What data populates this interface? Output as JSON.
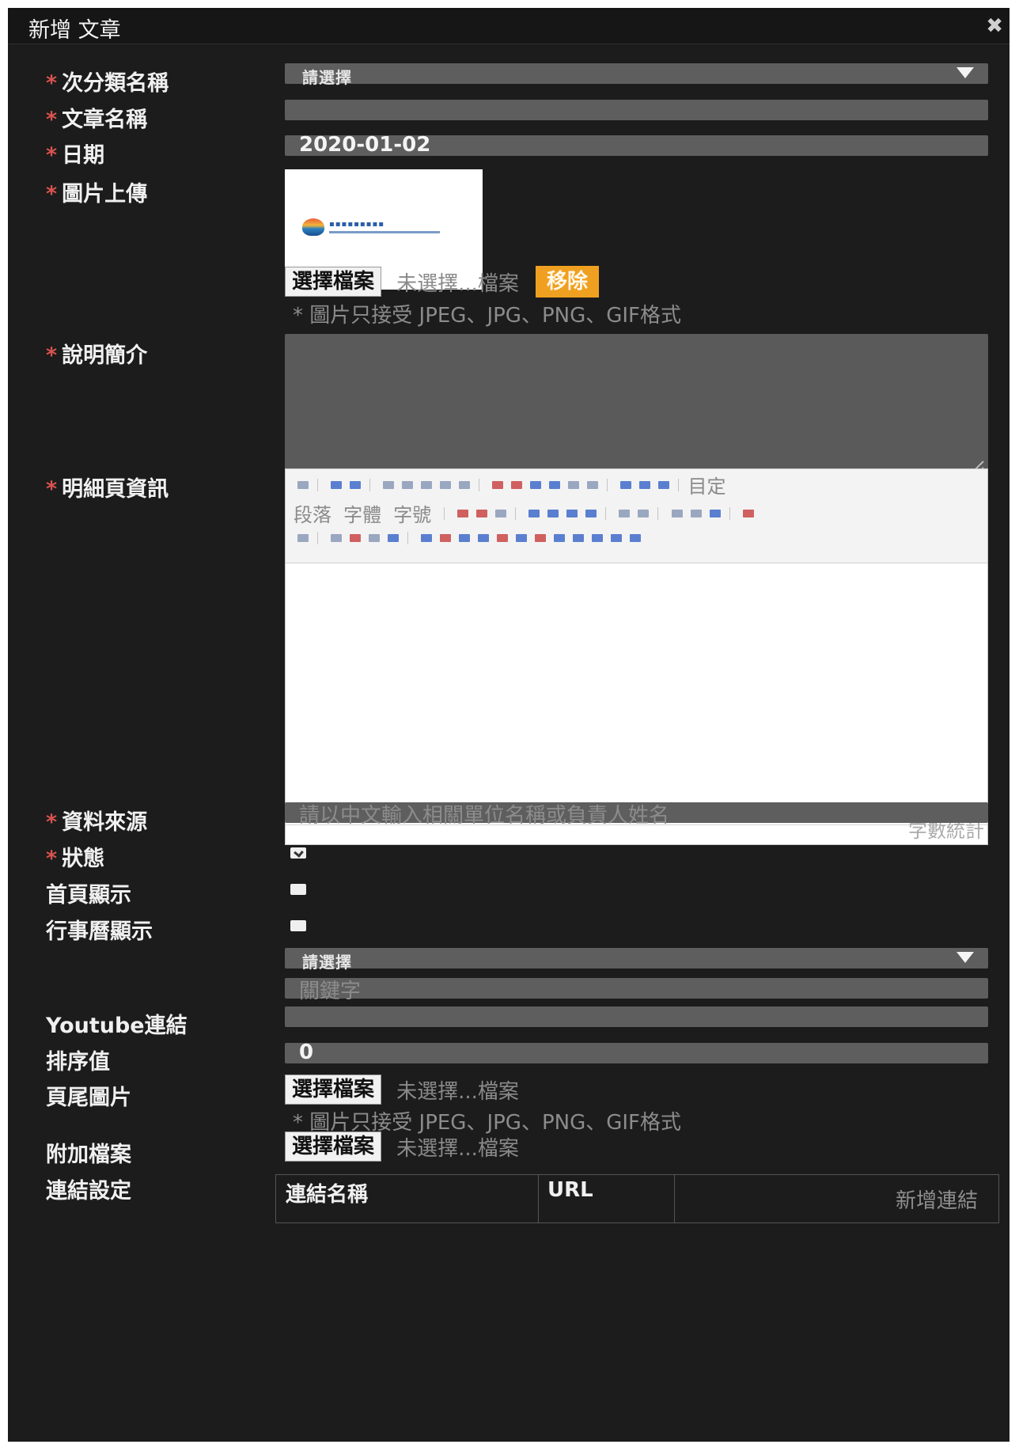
{
  "dialog": {
    "title": "新增 文章",
    "close_glyph": "✖"
  },
  "required_mark": "*",
  "fields": {
    "subcategory": {
      "label": "次分類名稱",
      "placeholder": "請選擇"
    },
    "article_name": {
      "label": "文章名稱",
      "value": ""
    },
    "date": {
      "label": "日期",
      "value": "2020-01-02"
    },
    "image_upload": {
      "label": "圖片上傳",
      "choose_button": "選擇檔案",
      "no_file": "未選擇...檔案",
      "remove_button": "移除",
      "hint": "* 圖片只接受 JPEG、JPG、PNG、GIF格式"
    },
    "description": {
      "label": "說明簡介",
      "value": ""
    },
    "detail_info": {
      "label": "明細頁資訊",
      "toolbar_dropdowns": [
        "段落",
        "字體",
        "字號"
      ],
      "toolbar_right": "目定",
      "word_count": "字數統計"
    },
    "data_source": {
      "label": "資料來源",
      "placeholder": "請以中文輸入相關單位名稱或負責人姓名"
    },
    "status": {
      "label": "狀態",
      "checked": true
    },
    "homepage_display": {
      "label": "首頁顯示",
      "checked": false
    },
    "calendar_display": {
      "label": "行事曆顯示",
      "checked": false
    },
    "keyword_select": {
      "placeholder": "請選擇"
    },
    "keyword": {
      "placeholder": "關鍵字"
    },
    "youtube": {
      "label": "Youtube連結",
      "value": ""
    },
    "sort": {
      "label": "排序值",
      "value": "0"
    },
    "footer_image": {
      "label": "頁尾圖片",
      "choose_button": "選擇檔案",
      "no_file": "未選擇...檔案",
      "hint": "* 圖片只接受 JPEG、JPG、PNG、GIF格式"
    },
    "attachment": {
      "label": "附加檔案",
      "choose_button": "選擇檔案",
      "no_file": "未選擇...檔案"
    },
    "links": {
      "label": "連結設定",
      "col_name": "連結名稱",
      "col_url": "URL",
      "add_button": "新增連結"
    }
  }
}
